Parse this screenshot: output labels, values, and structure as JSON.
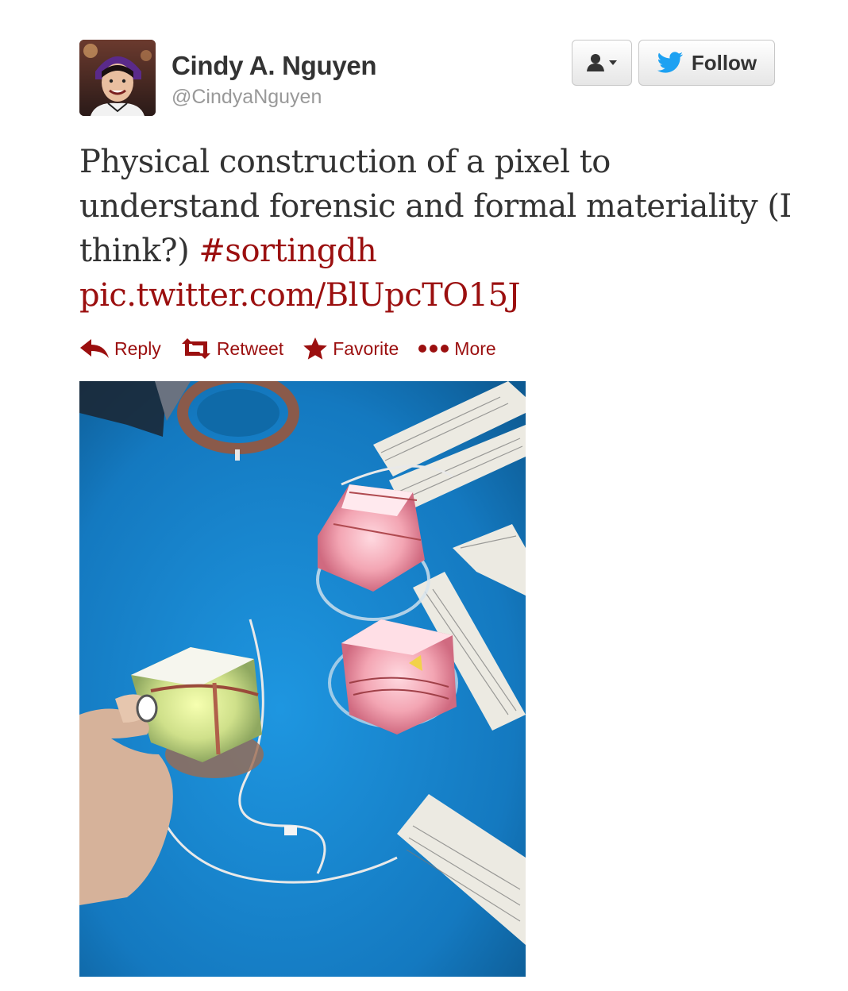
{
  "user": {
    "name": "Cindy A. Nguyen",
    "handle": "@CindyaNguyen"
  },
  "buttons": {
    "follow_label": "Follow"
  },
  "tweet": {
    "text_before": "Physical construction of a pixel to understand forensic and formal materiality (I think?) ",
    "hashtag": "#sortingdh",
    "pic_link": "pic.twitter.com/BlUpcTO15J"
  },
  "actions": {
    "reply": "Reply",
    "retweet": "Retweet",
    "favorite": "Favorite",
    "more": "More"
  },
  "colors": {
    "link": "#9b0f0f",
    "twitter_bird": "#1da1f2",
    "photo_background": "#1b8ad4"
  },
  "icons": {
    "user_dropdown": "person-dropdown-icon",
    "follow": "twitter-bird-icon",
    "reply": "reply-arrow-icon",
    "retweet": "retweet-icon",
    "favorite": "star-icon",
    "more": "ellipsis-icon"
  }
}
